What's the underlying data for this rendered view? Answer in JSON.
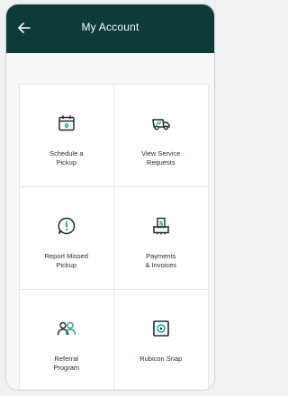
{
  "header": {
    "title": "My Account"
  },
  "tiles": [
    {
      "label": "Schedule a\nPickup",
      "icon": "calendar-pin-icon"
    },
    {
      "label": "View Service\nRequests",
      "icon": "truck-icon"
    },
    {
      "label": "Report Missed\nPickup",
      "icon": "alert-chat-icon"
    },
    {
      "label": "Payments\n& Invoices",
      "icon": "payment-icon"
    },
    {
      "label": "Referral\nProgram",
      "icon": "people-icon"
    },
    {
      "label": "Rubicon Snap",
      "icon": "camera-frame-icon"
    }
  ],
  "colors": {
    "header_bg": "#0d3b39",
    "accent": "#1aa89a",
    "icon_dark": "#1f2a2f"
  }
}
